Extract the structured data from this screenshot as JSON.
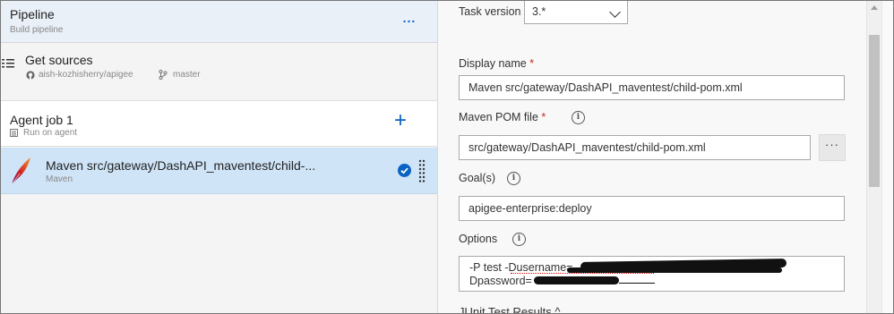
{
  "pipeline": {
    "title": "Pipeline",
    "subtitle": "Build pipeline",
    "more_label": "..."
  },
  "get_sources": {
    "title": "Get sources",
    "repo": "aish-kozhisherry/apigee",
    "branch": "master"
  },
  "agent_job": {
    "title": "Agent job 1",
    "subtitle": "Run on agent",
    "add_label": "+"
  },
  "task": {
    "title": "Maven src/gateway/DashAPI_maventest/child-...",
    "subtitle": "Maven"
  },
  "details": {
    "task_version": {
      "label": "Task version",
      "value": "3.*"
    },
    "display_name": {
      "label": "Display name",
      "required": "*",
      "value": "Maven src/gateway/DashAPI_maventest/child-pom.xml"
    },
    "pom_file": {
      "label": "Maven POM file",
      "required": "*",
      "value": "src/gateway/DashAPI_maventest/child-pom.xml",
      "browse_label": "···"
    },
    "goals": {
      "label": "Goal(s)",
      "value": "apigee-enterprise:deploy"
    },
    "options": {
      "label": "Options",
      "line1": "-P test -Dusername=",
      "line2": "Dpassword="
    },
    "junit_section": "JUnit Test Results ^"
  },
  "icons": {
    "info": "info-icon",
    "check": "check-circle-icon",
    "maven": "maven-feather-icon"
  },
  "colors": {
    "accent": "#0a63c2",
    "selected_row": "#cfe4f7",
    "required": "#c42b1c"
  }
}
